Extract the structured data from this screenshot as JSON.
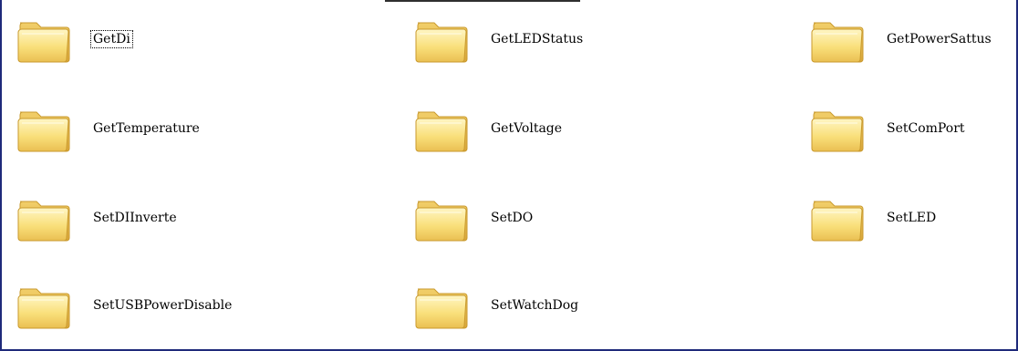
{
  "window": {
    "title": ""
  },
  "folders": [
    {
      "name": "GetDi",
      "focused": true,
      "icon": "folder-icon"
    },
    {
      "name": "GetLEDStatus",
      "icon": "folder-icon"
    },
    {
      "name": "GetPowerSattus",
      "icon": "folder-icon"
    },
    {
      "name": "GetTemperature",
      "icon": "folder-icon"
    },
    {
      "name": "GetVoltage",
      "icon": "folder-icon"
    },
    {
      "name": "SetComPort",
      "icon": "folder-icon"
    },
    {
      "name": "SetDIInverte",
      "icon": "folder-icon"
    },
    {
      "name": "SetDO",
      "icon": "folder-icon"
    },
    {
      "name": "SetLED",
      "icon": "folder-icon"
    },
    {
      "name": "SetUSBPowerDisable",
      "icon": "folder-icon"
    },
    {
      "name": "SetWatchDog",
      "icon": "folder-icon"
    }
  ],
  "colors": {
    "folder_light": "#fff4b8",
    "folder_mid": "#f8dc74",
    "folder_dark": "#e7b84a",
    "folder_outline": "#c99a2e",
    "window_border": "#1f2a7a"
  }
}
